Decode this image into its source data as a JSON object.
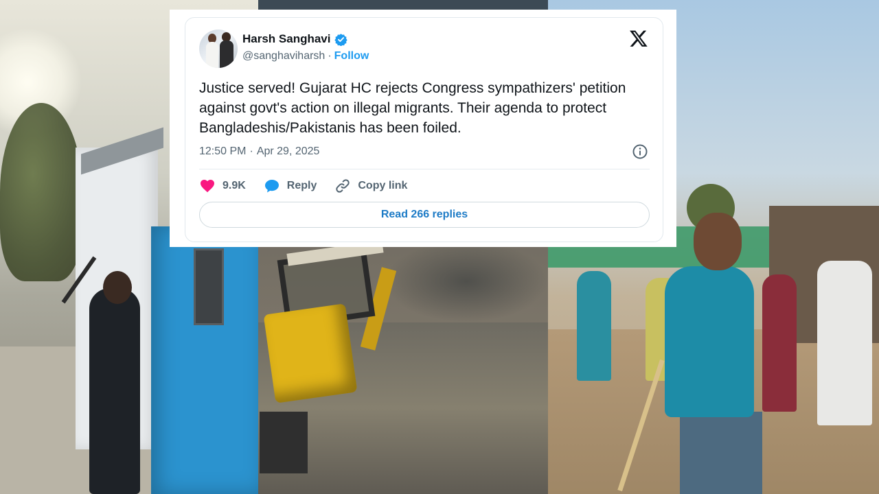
{
  "tweet": {
    "author_name": "Harsh Sanghavi",
    "handle": "@sanghaviharsh",
    "separator": "·",
    "follow_label": "Follow",
    "text": "Justice served! Gujarat HC rejects Congress sympathizers' petition against govt's action on illegal migrants. Their agenda to protect Bangladeshis/Pakistanis has been foiled.",
    "time": "12:50 PM",
    "date": "Apr 29, 2025",
    "likes": "9.9K",
    "reply_label": "Reply",
    "copy_link_label": "Copy link",
    "read_replies_label": "Read 266 replies"
  },
  "icons": {
    "platform": "x-logo-icon",
    "verified": "verified-badge-icon",
    "info": "info-icon",
    "like": "heart-icon",
    "reply": "speech-bubble-icon",
    "copy": "link-icon"
  },
  "colors": {
    "accent": "#1d9bf0",
    "like": "#f91880",
    "text": "#0f1419",
    "muted": "#536471"
  }
}
